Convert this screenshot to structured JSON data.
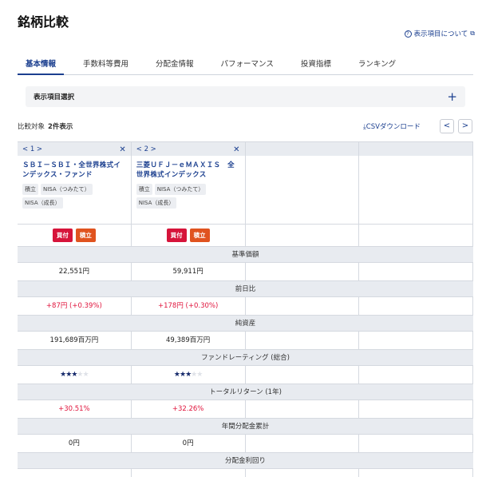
{
  "title": "銘柄比較",
  "about_link": "表示項目について",
  "tabs": [
    "基本情報",
    "手数料等費用",
    "分配金情報",
    "パフォーマンス",
    "投資指標",
    "ランキング"
  ],
  "select_panel": {
    "label": "表示項目選択",
    "plus": "+"
  },
  "count": {
    "label": "比較対象",
    "value": "2件表示"
  },
  "csv_label": "CSVダウンロード",
  "nav": {
    "prev": "<",
    "next": ">"
  },
  "columns": [
    {
      "index_label": "< 1 >",
      "close": "✕",
      "name": "ＳＢＩ－ＳＢＩ・全世界株式インデックス・ファンド",
      "tags": [
        "積立",
        "NISA（つみたて）",
        "NISA（成長）"
      ],
      "buy_label": "買付",
      "save_label": "積立"
    },
    {
      "index_label": "< 2 >",
      "close": "✕",
      "name": "三菱ＵＦＪ－ｅＭＡＸＩＳ　全世界株式インデックス",
      "tags": [
        "積立",
        "NISA（つみたて）",
        "NISA（成長）"
      ],
      "buy_label": "買付",
      "save_label": "積立"
    }
  ],
  "metrics": [
    {
      "label": "基準価額",
      "values": [
        "22,551円",
        "59,911円"
      ],
      "tone": "normal"
    },
    {
      "label": "前日比",
      "values": [
        "+87円 (+0.39%)",
        "+178円 (+0.30%)"
      ],
      "tone": "red"
    },
    {
      "label": "純資産",
      "values": [
        "191,689百万円",
        "49,389百万円"
      ],
      "tone": "normal"
    },
    {
      "label": "ファンドレーティング (総合)",
      "ratings": [
        3,
        3
      ],
      "max_rating": 5,
      "tone": "stars"
    },
    {
      "label": "トータルリターン (1年)",
      "values": [
        "+30.51%",
        "+32.26%"
      ],
      "tone": "red"
    },
    {
      "label": "年間分配金累計",
      "values": [
        "0円",
        "0円"
      ],
      "tone": "normal"
    },
    {
      "label": "分配金利回り",
      "values": [
        "-",
        "-"
      ],
      "tone": "normal"
    }
  ],
  "colors": {
    "accent": "#1b3f8f",
    "buy": "#d6143a",
    "save": "#e0531f",
    "positive": "#e0143c",
    "header_bg": "#e8ebf0"
  }
}
